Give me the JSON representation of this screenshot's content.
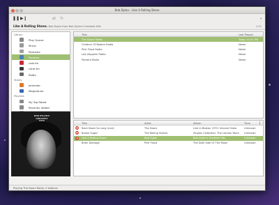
{
  "window": {
    "title": "Bob Dylan - Like A Rolling Stone"
  },
  "toolbar": {
    "play_pause_icon": "pause-icon",
    "next_icon": "skip-next-icon",
    "shuffle_icon": "shuffle-icon",
    "repeat_icon": "repeat-icon",
    "volume_icon": "volume-icon"
  },
  "now_playing": {
    "song": "Like A Rolling Stone",
    "by_line": "by Bob Dylan from Bob Dylan's Greatest Hits",
    "time": "1:11"
  },
  "sidebar": {
    "sections": [
      {
        "header": "Library",
        "items": [
          {
            "label": "Play Queue",
            "icon": "play-queue-icon",
            "color": "#8a8a8a",
            "selected": false
          },
          {
            "label": "Music",
            "icon": "music-icon",
            "color": "#9a9a9a",
            "selected": false
          },
          {
            "label": "Podcasts",
            "icon": "podcast-icon",
            "color": "#a0a0a0",
            "selected": false
          },
          {
            "label": "Pandora",
            "icon": "pandora-icon",
            "color": "#4a7fb8",
            "selected": true
          },
          {
            "label": "Last.fm",
            "icon": "lastfm-icon",
            "color": "#c8283a",
            "selected": false
          },
          {
            "label": "Libre.fm",
            "icon": "librefm-icon",
            "color": "#3a3a3a",
            "selected": false
          },
          {
            "label": "Radio",
            "icon": "radio-icon",
            "color": "#6a6a6a",
            "selected": false
          }
        ]
      },
      {
        "header": "Stores",
        "items": [
          {
            "label": "Jamendo",
            "icon": "jamendo-icon",
            "color": "#e07a2a",
            "selected": false
          },
          {
            "label": "Magnatune",
            "icon": "magnatune-icon",
            "color": "#3a66b0",
            "selected": false
          }
        ]
      },
      {
        "header": "Playlists",
        "items": [
          {
            "label": "My Top Rated",
            "icon": "playlist-icon",
            "color": "#8a8a8a",
            "selected": false
          },
          {
            "label": "Recently Added",
            "icon": "playlist-icon",
            "color": "#8a8a8a",
            "selected": false
          },
          {
            "label": "Recently Played",
            "icon": "playlist-icon",
            "color": "#8a8a8a",
            "selected": false
          }
        ]
      }
    ]
  },
  "album_art": {
    "text": "BOB DYLAN'S GREATEST HITS"
  },
  "stations": {
    "columns": [
      "Title",
      "Last Played"
    ],
    "rows": [
      {
        "title": "The Doors Radio",
        "last_played": "Today 01:41 PM",
        "selected": true
      },
      {
        "title": "Children Of Bodom Radio",
        "last_played": "Never",
        "selected": false
      },
      {
        "title": "Pink Floyd Radio",
        "last_played": "Never",
        "selected": false
      },
      {
        "title": "Led Zeppelin Radio",
        "last_played": "Never",
        "selected": false
      },
      {
        "title": "Pantera Radio",
        "last_played": "Never",
        "selected": false
      }
    ]
  },
  "tracks": {
    "columns": [
      "Title",
      "Artist",
      "Album",
      "Time"
    ],
    "rows": [
      {
        "title": "Back Down So Long (Live)",
        "artist": "The Doors",
        "album": "Live in Boston 1970: Second Show",
        "time": "Unknown",
        "status_icon": "no-entry-icon",
        "selected": false
      },
      {
        "title": "Brown Sugar",
        "artist": "The Rolling Stones",
        "album": "Singles Collection: The London Years",
        "time": "Unknown",
        "status_icon": "no-entry-icon",
        "selected": false
      },
      {
        "title": "Like A Rolling Stone",
        "artist": "Bob Dylan",
        "album": "Bob Dylan's Greatest Hits",
        "time": "Unknown",
        "status_icon": "play-icon",
        "selected": true
      },
      {
        "title": "Brain Damage",
        "artist": "Pink Floyd",
        "album": "The Dark Side Of The Moon",
        "time": "Unknown",
        "status_icon": "",
        "selected": false
      }
    ]
  },
  "status": {
    "text": "Playing The Doors Radio, 5 stations"
  },
  "colors": {
    "selection": "#9fbf72",
    "accent_red": "#d24a3b"
  }
}
